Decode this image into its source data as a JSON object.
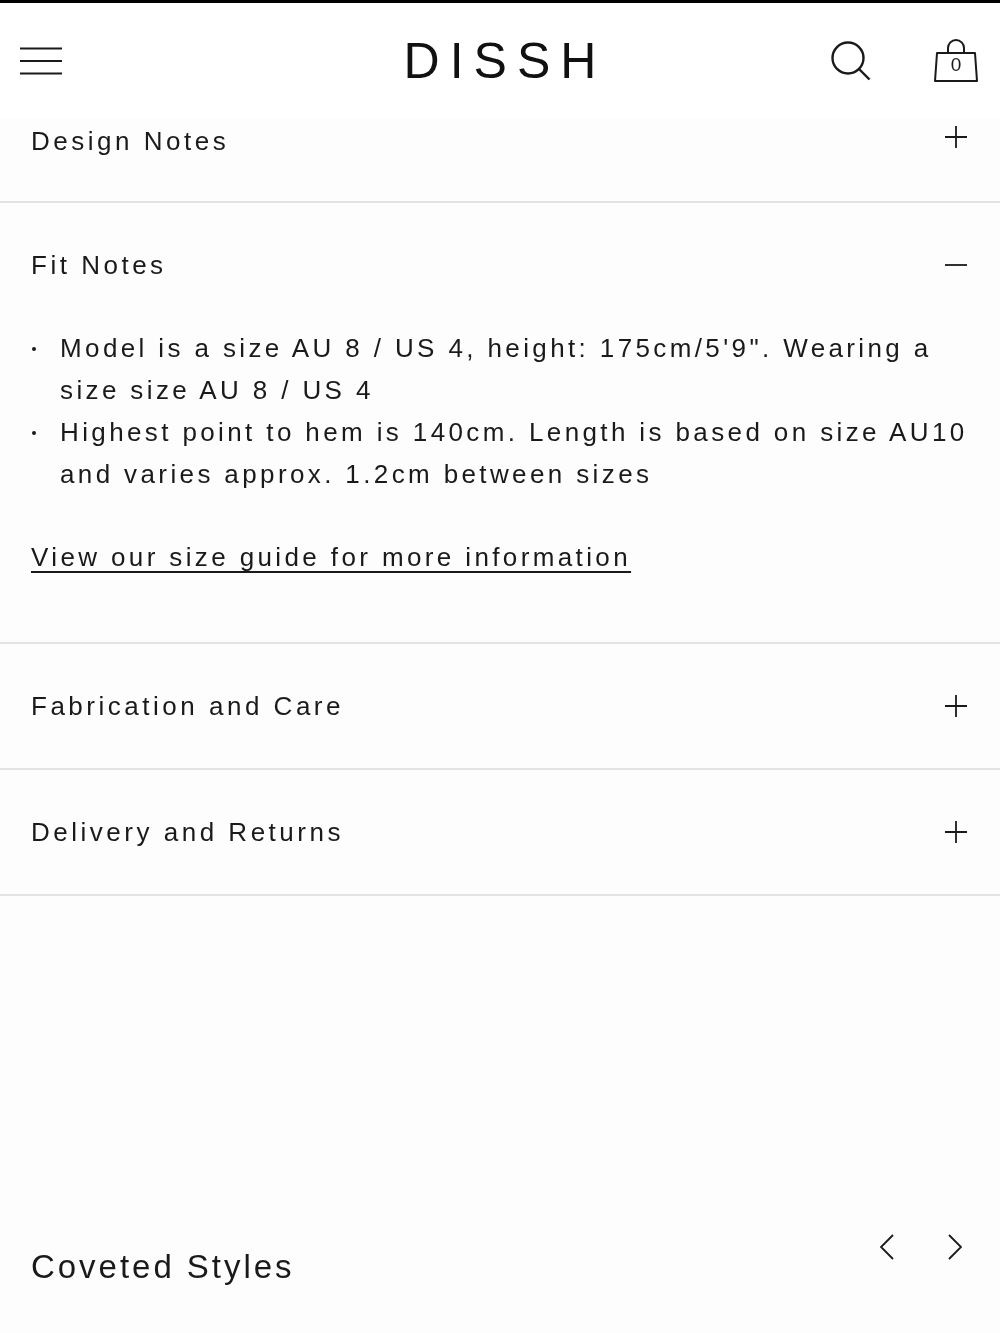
{
  "header": {
    "logo": "DISSH",
    "cart_count": "0"
  },
  "accordion": [
    {
      "title": "Design Notes",
      "expanded": false
    },
    {
      "title": "Fit Notes",
      "expanded": true,
      "bullets": [
        "Model is a size AU 8 / US 4, height: 175cm/5'9\". Wearing a size size AU 8 / US 4",
        "Highest point to hem is 140cm. Length is based on size AU10 and varies approx. 1.2cm between sizes"
      ],
      "link": "View our size guide for more information"
    },
    {
      "title": "Fabrication and Care",
      "expanded": false
    },
    {
      "title": "Delivery and Returns",
      "expanded": false
    }
  ],
  "carousel": {
    "title": "Coveted Styles"
  }
}
